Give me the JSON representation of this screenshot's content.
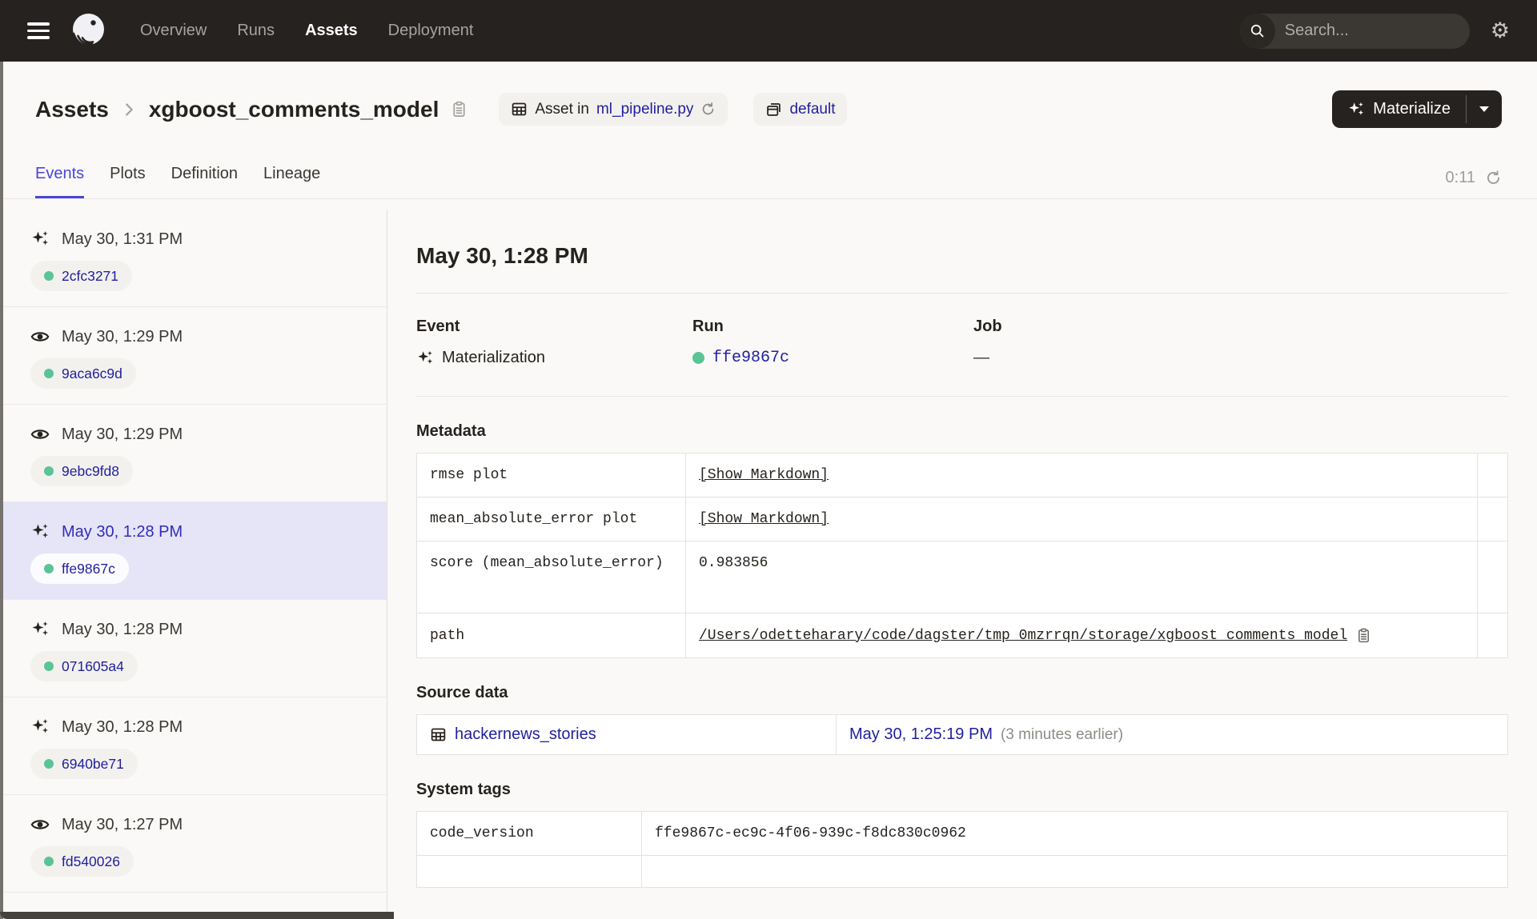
{
  "colors": {
    "nav_bg": "#262220",
    "page_bg": "#FAF9F7",
    "accent": "#4A43DC",
    "link": "#201F9E",
    "selected_row_bg": "#E6E4F7",
    "success_green": "#5AC497",
    "border": "#E5E2DE",
    "text": "#26221E",
    "muted": "#8F8B86"
  },
  "topnav": {
    "menu": [
      "Overview",
      "Runs",
      "Assets",
      "Deployment"
    ],
    "active": "Assets",
    "search_placeholder": "Search...",
    "search_shortcut": "/"
  },
  "breadcrumb": {
    "root": "Assets",
    "asset_name": "xgboost_comments_model"
  },
  "badges": {
    "asset_in_prefix": "Asset in",
    "code_file": "ml_pipeline.py",
    "group": "default"
  },
  "toolbar": {
    "materialize_label": "Materialize"
  },
  "tabs": {
    "items": [
      "Events",
      "Plots",
      "Definition",
      "Lineage"
    ],
    "active": "Events"
  },
  "refresh": {
    "countdown": "0:11"
  },
  "sidebar": {
    "events": [
      {
        "type": "materialization",
        "time": "May 30, 1:31 PM",
        "run_id": "2cfc3271"
      },
      {
        "type": "observation",
        "time": "May 30, 1:29 PM",
        "run_id": "9aca6c9d"
      },
      {
        "type": "observation",
        "time": "May 30, 1:29 PM",
        "run_id": "9ebc9fd8"
      },
      {
        "type": "materialization",
        "time": "May 30, 1:28 PM",
        "run_id": "ffe9867c",
        "selected": true
      },
      {
        "type": "materialization",
        "time": "May 30, 1:28 PM",
        "run_id": "071605a4"
      },
      {
        "type": "materialization",
        "time": "May 30, 1:28 PM",
        "run_id": "6940be71"
      },
      {
        "type": "observation",
        "time": "May 30, 1:27 PM",
        "run_id": "fd540026"
      }
    ]
  },
  "detail": {
    "title": "May 30, 1:28 PM",
    "event_label": "Event",
    "event_value": "Materialization",
    "run_label": "Run",
    "run_value": "ffe9867c",
    "job_label": "Job",
    "job_value": "—",
    "metadata": {
      "heading": "Metadata",
      "rows": [
        {
          "key": "rmse plot",
          "value": "[Show Markdown]"
        },
        {
          "key": "mean_absolute_error plot",
          "value": "[Show Markdown]"
        },
        {
          "key": "score (mean_absolute_error)",
          "value": "0.983856"
        },
        {
          "key": "path",
          "value": "/Users/odetteharary/code/dagster/tmp_0mzrrqn/storage/xgboost_comments_model"
        }
      ]
    },
    "source_data": {
      "heading": "Source data",
      "asset": "hackernews_stories",
      "time": "May 30, 1:25:19 PM",
      "note": "(3 minutes earlier)"
    },
    "system_tags": {
      "heading": "System tags",
      "rows": [
        {
          "key": "code_version",
          "value": "ffe9867c-ec9c-4f06-939c-f8dc830c0962"
        }
      ]
    }
  }
}
